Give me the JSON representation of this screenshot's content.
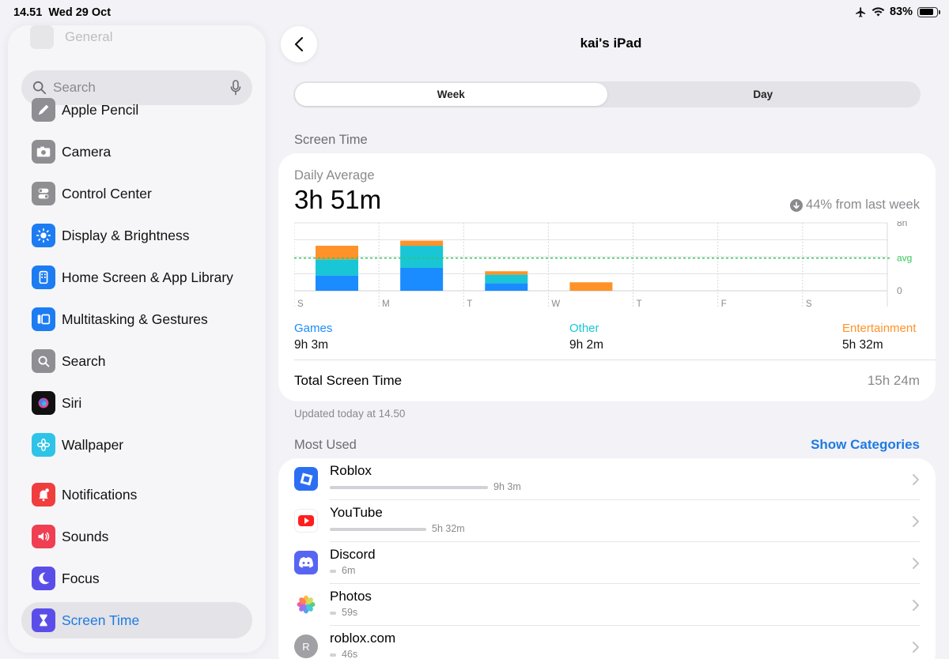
{
  "status": {
    "time": "14.51",
    "date": "Wed 29 Oct",
    "battery": "83%",
    "battery_level": 0.83
  },
  "sidebar": {
    "faded_item": "General",
    "search_placeholder": "Search",
    "items": [
      {
        "label": "Apple Pencil",
        "icon": "pencil-icon",
        "color": "#8e8e93"
      },
      {
        "label": "Camera",
        "icon": "camera-icon",
        "color": "#8e8e93"
      },
      {
        "label": "Control Center",
        "icon": "toggles-icon",
        "color": "#8e8e93"
      },
      {
        "label": "Display & Brightness",
        "icon": "sun-icon",
        "color": "#1d7cf2"
      },
      {
        "label": "Home Screen & App Library",
        "icon": "home-grid-icon",
        "color": "#1d7cf2"
      },
      {
        "label": "Multitasking & Gestures",
        "icon": "multitask-icon",
        "color": "#1d7cf2"
      },
      {
        "label": "Search",
        "icon": "magnifier-icon",
        "color": "#8e8e93"
      },
      {
        "label": "Siri",
        "icon": "siri-icon",
        "color": "#222"
      },
      {
        "label": "Wallpaper",
        "icon": "flower-icon",
        "color": "#2fc3e8"
      },
      {
        "label": "Notifications",
        "icon": "bell-icon",
        "color": "#f03e3e"
      },
      {
        "label": "Sounds",
        "icon": "speaker-icon",
        "color": "#f03e52"
      },
      {
        "label": "Focus",
        "icon": "moon-icon",
        "color": "#5b4ee8"
      },
      {
        "label": "Screen Time",
        "icon": "hourglass-icon",
        "color": "#5b4ee8"
      }
    ]
  },
  "header": {
    "title": "kai's iPad",
    "tabs": [
      "Week",
      "Day"
    ],
    "active_tab": "Week"
  },
  "screen_time": {
    "section_title": "Screen Time",
    "daily_label": "Daily Average",
    "daily_value": "3h 51m",
    "trend": "44% from last week",
    "categories": [
      {
        "name": "Games",
        "value": "9h 3m",
        "color": "#1a8cff"
      },
      {
        "name": "Other",
        "value": "9h 2m",
        "color": "#19c6d6"
      },
      {
        "name": "Entertainment",
        "value": "5h 32m",
        "color": "#ff9228"
      }
    ],
    "total_label": "Total Screen Time",
    "total_value": "15h 24m",
    "updated": "Updated today at 14.50"
  },
  "chart_data": {
    "type": "bar",
    "categories": [
      "S",
      "M",
      "T",
      "W",
      "T",
      "F",
      "S"
    ],
    "series": [
      {
        "name": "Games",
        "values": [
          1.8,
          2.7,
          0.9,
          0,
          0,
          0,
          0
        ]
      },
      {
        "name": "Other",
        "values": [
          1.9,
          2.6,
          1.0,
          0,
          0,
          0,
          0
        ]
      },
      {
        "name": "Entertainment",
        "values": [
          1.6,
          0.6,
          0.4,
          1.0,
          0,
          0,
          0
        ]
      }
    ],
    "ylim": [
      0,
      8
    ],
    "y_ticks": [
      "8h",
      "avg",
      "0"
    ],
    "avg": 3.85,
    "stacked": true
  },
  "most_used": {
    "title": "Most Used",
    "show_categories": "Show Categories",
    "apps": [
      {
        "name": "Roblox",
        "time": "9h 3m",
        "fraction": 1.0,
        "icon": "roblox-icon"
      },
      {
        "name": "YouTube",
        "time": "5h 32m",
        "fraction": 0.61,
        "icon": "youtube-icon"
      },
      {
        "name": "Discord",
        "time": "6m",
        "fraction": 0.02,
        "icon": "discord-icon"
      },
      {
        "name": "Photos",
        "time": "59s",
        "fraction": 0.01,
        "icon": "photos-icon"
      },
      {
        "name": "roblox.com",
        "time": "46s",
        "fraction": 0.01,
        "icon": "letter-r-icon",
        "letter": "R"
      }
    ]
  }
}
